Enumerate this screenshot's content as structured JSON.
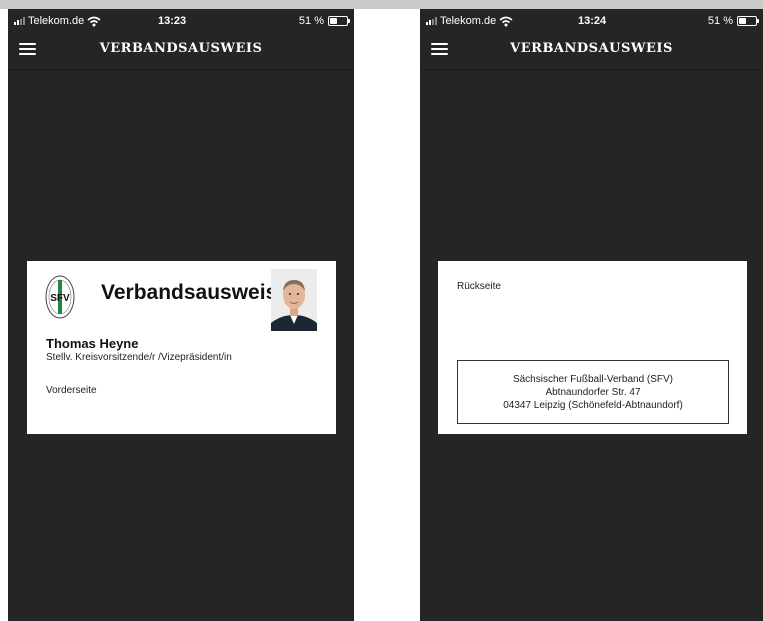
{
  "screens": [
    {
      "status": {
        "carrier": "Telekom.de",
        "time": "13:23",
        "battery": "51 %",
        "battery_level": 0.51
      },
      "nav": {
        "title": "VERBANDSAUSWEIS"
      },
      "card": {
        "title": "Verbandsausweis",
        "name": "Thomas Heyne",
        "role": "Stellv. Kreisvorsitzende/r /Vizepräsident/in",
        "side_label": "Vorderseite",
        "logo_text": "SFV"
      }
    },
    {
      "status": {
        "carrier": "Telekom.de",
        "time": "13:24",
        "battery": "51 %",
        "battery_level": 0.51
      },
      "nav": {
        "title": "VERBANDSAUSWEIS"
      },
      "card": {
        "side_label": "Rückseite",
        "address": [
          "Sächsischer Fußball-Verband (SFV)",
          "Abtnaundorfer Str. 47",
          "04347 Leipzig (Schönefeld-Abtnaundorf)"
        ]
      }
    }
  ],
  "colors": {
    "app_background": "#252525",
    "card_background": "#ffffff",
    "logo_green": "#1f8a3d"
  }
}
